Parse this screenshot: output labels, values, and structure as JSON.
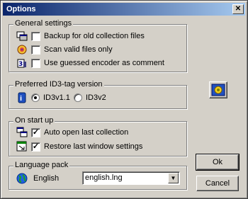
{
  "window": {
    "title": "Options",
    "close_label": "✕"
  },
  "general": {
    "legend": "General settings",
    "items": [
      {
        "label": "Backup for old collection files",
        "checked": false
      },
      {
        "label": "Scan valid files only",
        "checked": false
      },
      {
        "label": "Use guessed encoder as comment",
        "checked": false
      }
    ]
  },
  "id3": {
    "legend": "Preferred ID3-tag version",
    "options": [
      {
        "label": "ID3v1.1",
        "selected": true
      },
      {
        "label": "ID3v2",
        "selected": false
      }
    ]
  },
  "startup": {
    "legend": "On start up",
    "items": [
      {
        "label": "Auto open last collection",
        "checked": true
      },
      {
        "label": "Restore last window settings",
        "checked": true
      }
    ]
  },
  "language": {
    "legend": "Language pack",
    "name": "English",
    "selected_file": "english.lng"
  },
  "buttons": {
    "ok": "Ok",
    "cancel": "Cancel"
  }
}
